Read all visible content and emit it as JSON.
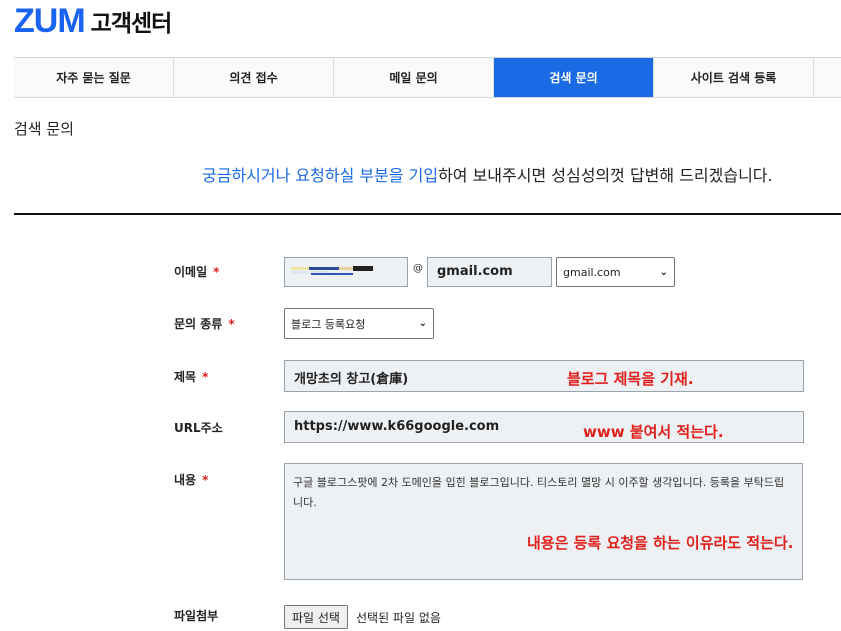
{
  "header": {
    "logo": "ZUM",
    "subtitle": "고객센터"
  },
  "tabs": [
    {
      "label": "자주 묻는 질문"
    },
    {
      "label": "의견 접수"
    },
    {
      "label": "메일 문의"
    },
    {
      "label": "검색 문의"
    },
    {
      "label": "사이트 검색 등록"
    }
  ],
  "active_tab": "검색 문의",
  "page": {
    "title": "검색 문의",
    "intro_highlight": "궁금하시거나 요청하실 부분을 기입",
    "intro_rest": "하여 보내주시면 성심성의껏 답변해 드리겠습니다."
  },
  "form": {
    "email": {
      "label": "이메일",
      "at": "@",
      "domain_value": "gmail.com",
      "domain_select": "gmail.com"
    },
    "type": {
      "label": "문의 종류",
      "value": "블로그 등록요청"
    },
    "title": {
      "label": "제목",
      "value": "개망초의 창고(倉庫)"
    },
    "url": {
      "label": "URL주소",
      "value": "https://www.k66google.com"
    },
    "content": {
      "label": "내용",
      "value": "구글 블로그스팟에 2차 도메인을 입힌 블로그입니다. 티스토리 멸망 시 이주할 생각입니다. 등록을 부탁드립니다."
    },
    "file": {
      "label": "파일첨부",
      "button": "파일 선택",
      "status": "선택된 파일 없음"
    },
    "required_mark": "*"
  },
  "annotations": {
    "title_note": "블로그 제목을 기재.",
    "url_note": "www 붙여서 적는다.",
    "content_note": "내용은 등록 요청을 하는 이유라도 적는다."
  },
  "colors": {
    "brand": "#1a63f0",
    "active_tab": "#1a6ae6",
    "required": "#e02020",
    "annotation": "#e0201c"
  }
}
